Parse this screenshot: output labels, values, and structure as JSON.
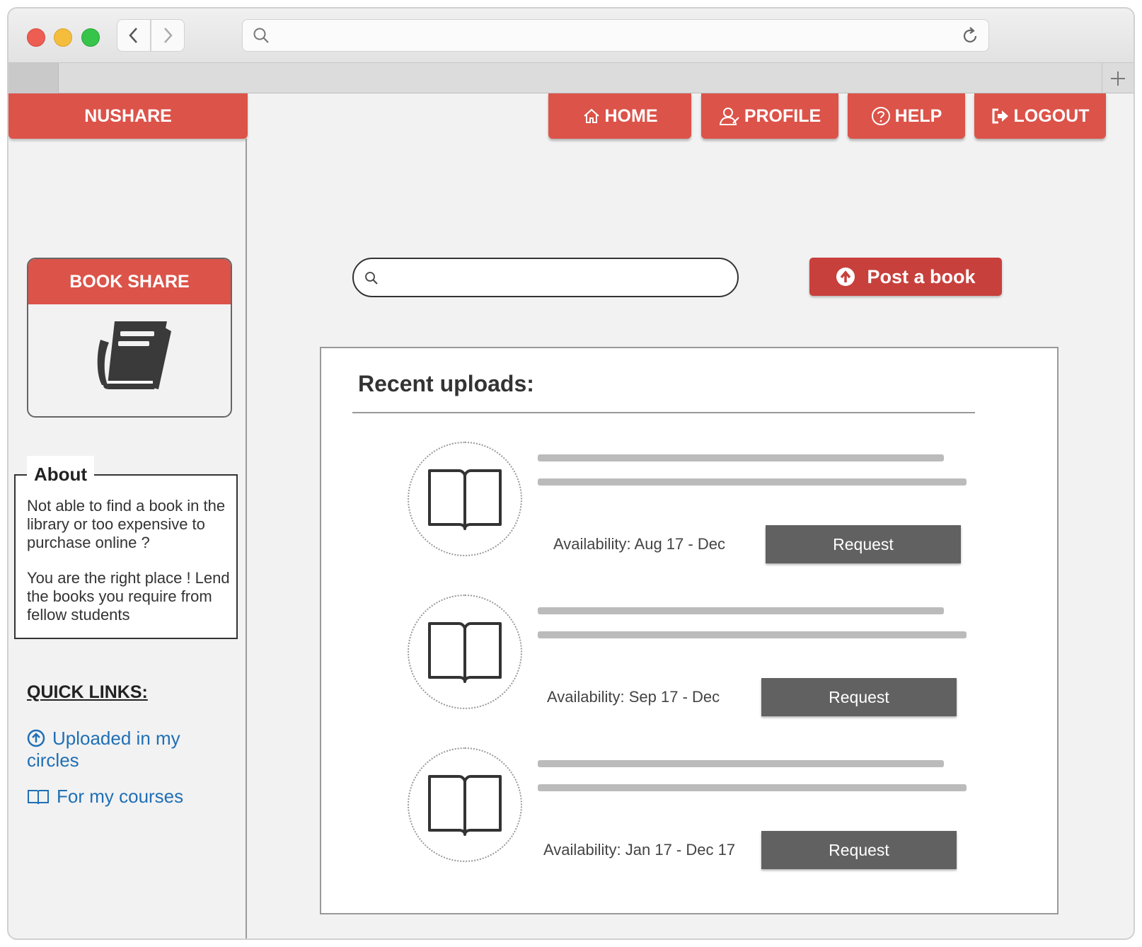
{
  "browser": {
    "back_icon": "chevron-left-icon",
    "forward_icon": "chevron-right-icon",
    "url_value": "",
    "new_tab_icon": "plus-icon"
  },
  "app": {
    "brand": "NUSHARE",
    "accent_color": "#dc5349",
    "nav": [
      {
        "label": "HOME",
        "icon": "home-icon"
      },
      {
        "label": "PROFILE",
        "icon": "user-icon"
      },
      {
        "label": "HELP",
        "icon": "question-icon"
      },
      {
        "label": "LOGOUT",
        "icon": "logout-icon"
      }
    ]
  },
  "sidebar": {
    "card_title": "BOOK SHARE",
    "card_icon": "book-icon",
    "about_title": "About",
    "about_p1": "Not able to find a book in the library or too expensive to purchase online ?",
    "about_p2": "You are the right place ! Lend the books you require from fellow students",
    "quick_links_title": "QUICK LINKS:",
    "quick_links": [
      {
        "label": "Uploaded in my circles",
        "icon": "upload-circle-icon"
      },
      {
        "label": "For my courses",
        "icon": "open-book-icon"
      }
    ]
  },
  "main": {
    "search_value": "",
    "post_button": "Post a book",
    "panel_title": "Recent uploads:",
    "uploads": [
      {
        "availability": "Availability: Aug 17 - Dec",
        "button": "Request"
      },
      {
        "availability": "Availability: Sep 17 - Dec",
        "button": "Request"
      },
      {
        "availability": "Availability: Jan 17 - Dec 17",
        "button": "Request"
      }
    ]
  }
}
